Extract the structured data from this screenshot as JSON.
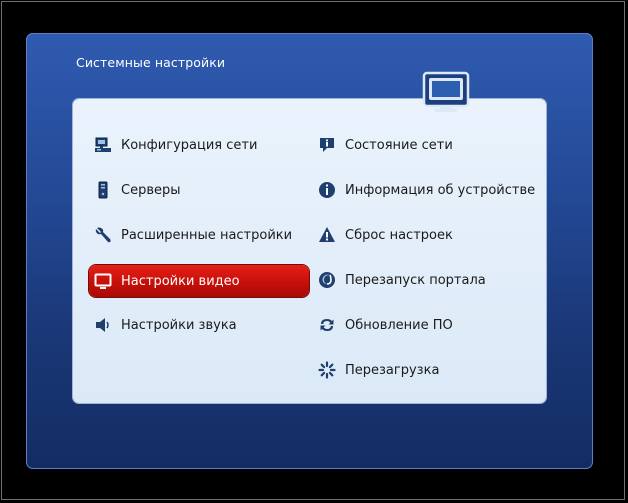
{
  "window": {
    "title": "Системные настройки"
  },
  "menu": {
    "left": [
      {
        "label": "Конфигурация сети",
        "icon": "network-computer-icon"
      },
      {
        "label": "Серверы",
        "icon": "server-icon"
      },
      {
        "label": "Расширенные настройки",
        "icon": "wrench-icon"
      },
      {
        "label": "Настройки видео",
        "icon": "monitor-icon",
        "selected": true
      },
      {
        "label": "Настройки звука",
        "icon": "speaker-icon"
      }
    ],
    "right": [
      {
        "label": "Состояние сети",
        "icon": "info-bubble-icon"
      },
      {
        "label": "Информация об устройстве",
        "icon": "info-circle-icon"
      },
      {
        "label": "Сброс настроек",
        "icon": "warning-icon"
      },
      {
        "label": "Перезапуск портала",
        "icon": "portal-restart-icon"
      },
      {
        "label": "Обновление ПО",
        "icon": "refresh-icon"
      },
      {
        "label": "Перезагрузка",
        "icon": "reboot-icon"
      }
    ]
  },
  "colors": {
    "selected_background": "#d4140f",
    "window_background": "#244a97",
    "panel_background": "#e3eef9"
  }
}
